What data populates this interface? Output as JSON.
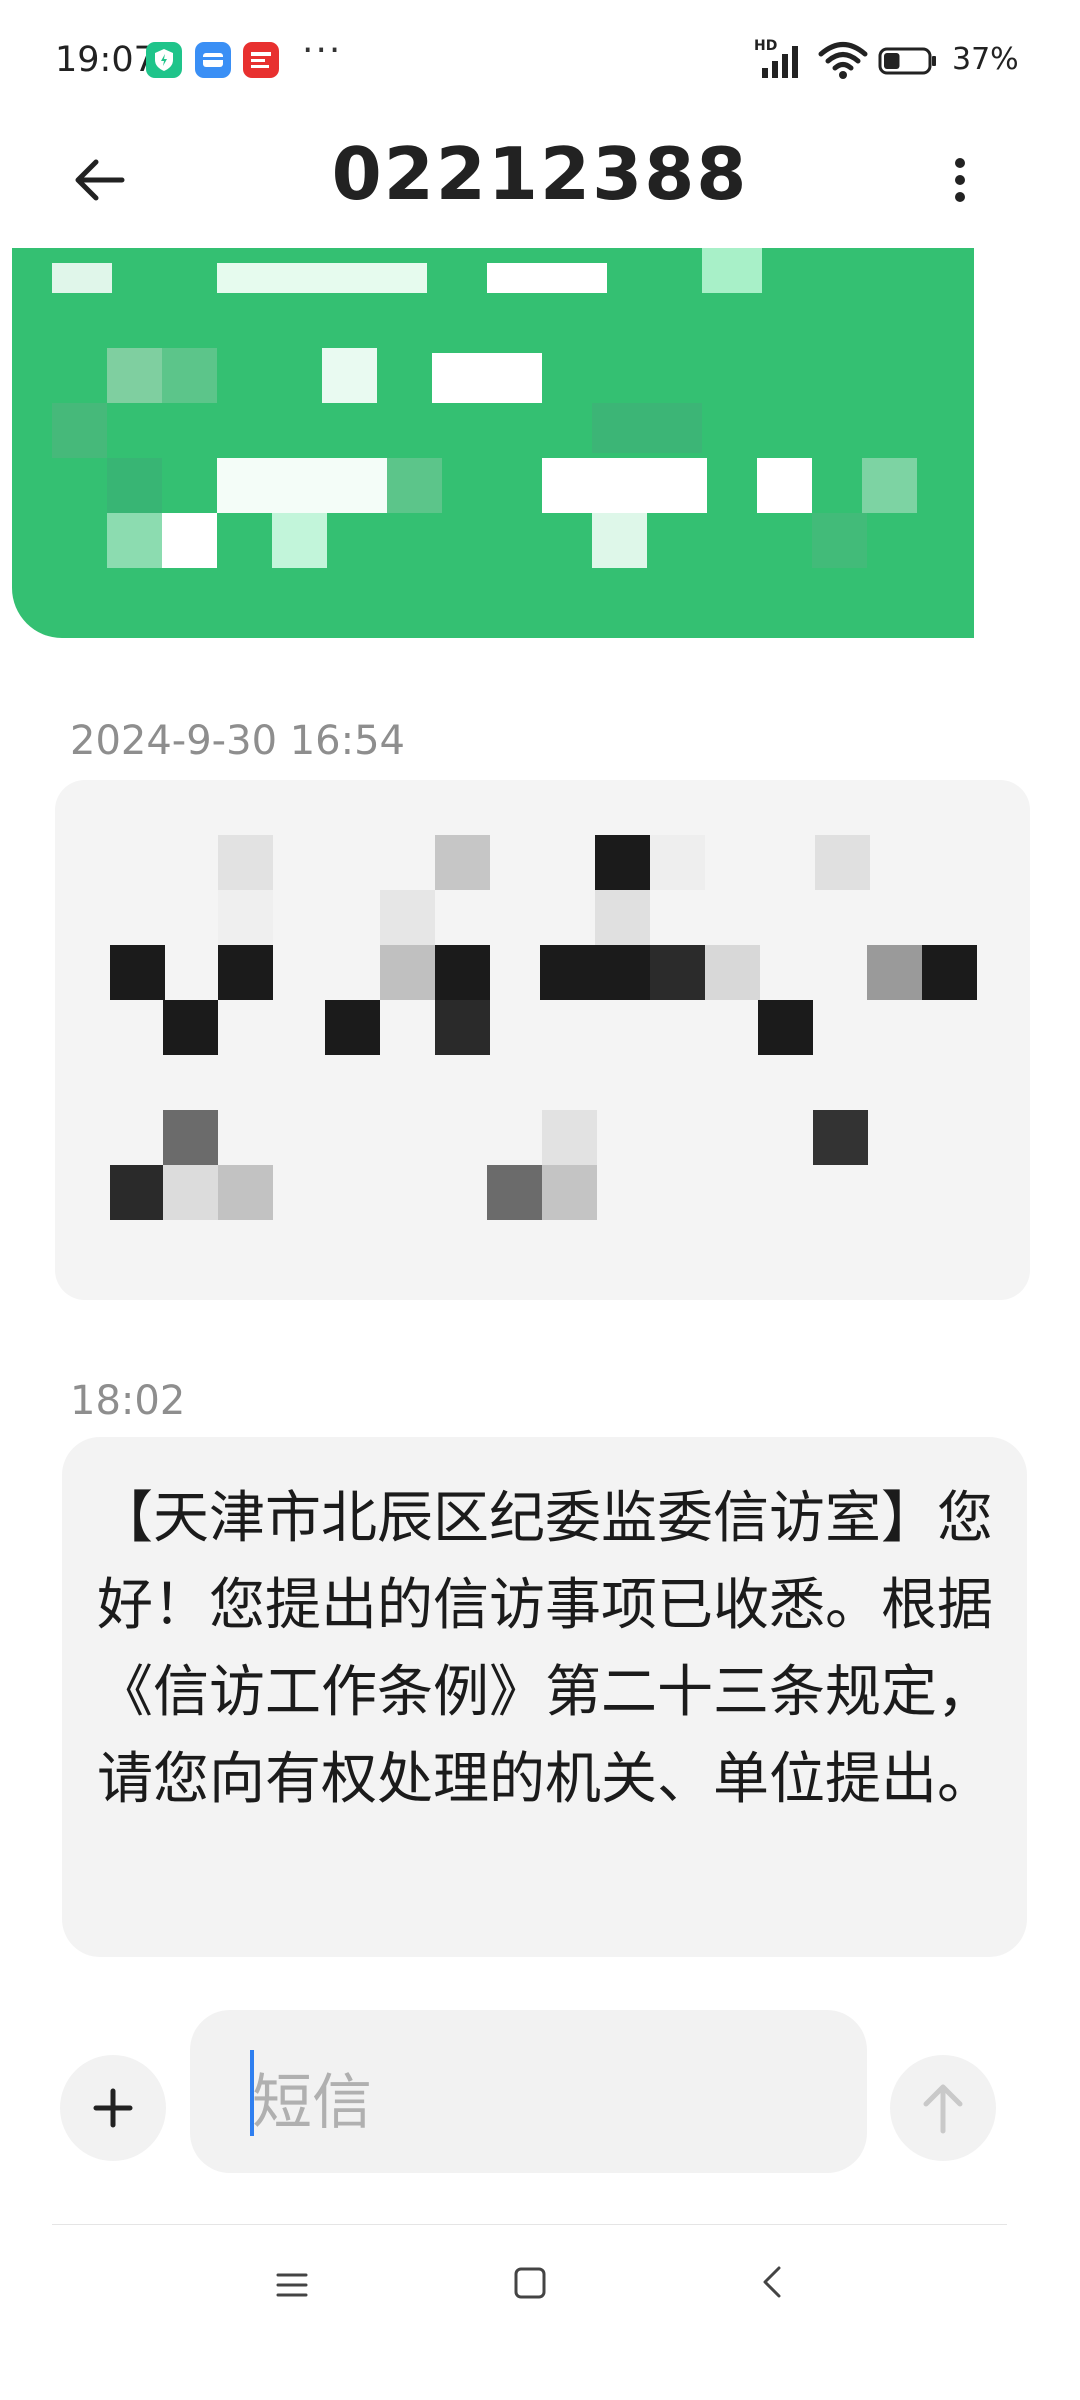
{
  "status_bar": {
    "time": "19:07",
    "icons": [
      "shield-app-icon",
      "wallet-app-icon",
      "news-app-icon"
    ],
    "more": "···",
    "network": "HD",
    "battery_percent": "37%",
    "battery_level": 0.37
  },
  "header": {
    "title": "02212388",
    "back_icon": "arrow-left-icon",
    "menu_icon": "more-vertical-icon"
  },
  "messages": [
    {
      "type": "received",
      "redacted": true,
      "color": "#34c072"
    },
    {
      "timestamp": "2024-9-30 16:54",
      "redacted": true
    },
    {
      "timestamp": "18:02",
      "text": "【天津市北辰区纪委监委信访室】您好！您提出的信访事项已收悉。根据《信访工作条例》第二十三条规定，请您向有权处理的机关、单位提出。"
    }
  ],
  "composer": {
    "placeholder": "短信",
    "add_icon": "plus-icon",
    "send_icon": "arrow-up-icon"
  },
  "nav_bar": {
    "icons": [
      "menu-icon",
      "home-icon",
      "back-icon"
    ]
  }
}
